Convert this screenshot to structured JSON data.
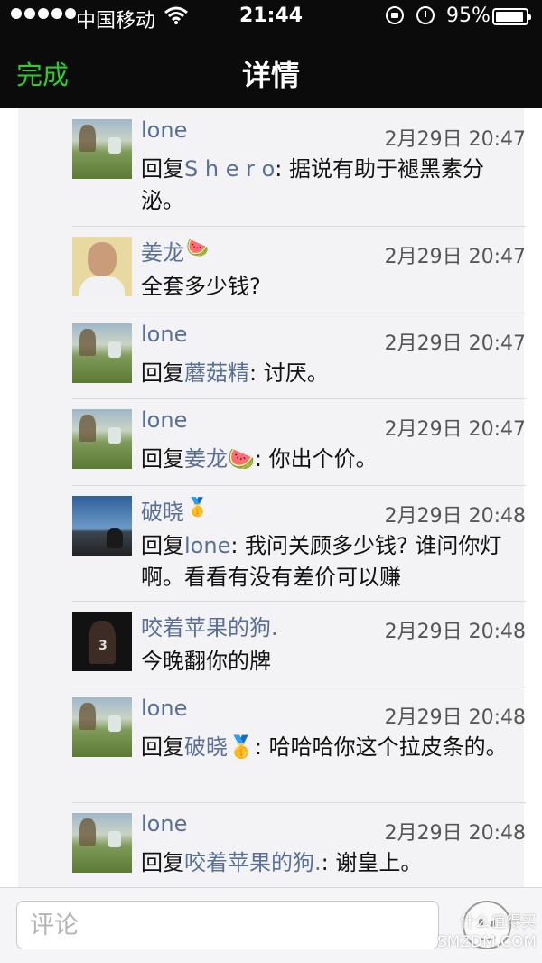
{
  "status_bar": {
    "carrier": "中国移动",
    "time": "21:44",
    "battery_percent": "95%",
    "battery_level": 0.95
  },
  "nav": {
    "done_label": "完成",
    "title": "详情"
  },
  "comments": [
    {
      "name": "lone",
      "time": "2月29日 20:47",
      "prefix": "回复",
      "ref": "S h e r o",
      "text": ": 据说有助于褪黑素分泌。",
      "avatar": "landscape-photo"
    },
    {
      "name": "姜龙",
      "name_emoji": "🍉",
      "time": "2月29日 20:47",
      "prefix": "",
      "ref": "",
      "text": "全套多少钱?",
      "avatar": "portrait-photo"
    },
    {
      "name": "lone",
      "time": "2月29日 20:47",
      "prefix": "回复",
      "ref": "蘑菇精",
      "text": ": 讨厌。",
      "avatar": "landscape-photo"
    },
    {
      "name": "lone",
      "time": "2月29日 20:47",
      "prefix": "回复",
      "ref": "姜龙🍉",
      "text": ": 你出个价。",
      "avatar": "landscape-photo"
    },
    {
      "name": "破晓",
      "name_emoji": "🥇",
      "time": "2月29日 20:48",
      "prefix": "回复",
      "ref": "lone",
      "text": ": 我问关顾多少钱? 谁问你灯啊。看看有没有差价可以赚",
      "avatar": "lake-photo"
    },
    {
      "name": "咬着苹果的狗.",
      "time": "2月29日 20:48",
      "prefix": "",
      "ref": "",
      "text": "今晚翻你的牌",
      "avatar": "basketball-jersey-photo"
    },
    {
      "name": "lone",
      "time": "2月29日 20:48",
      "prefix": "回复",
      "ref": "破晓🥇",
      "text": ": 哈哈哈你这个拉皮条的。",
      "avatar": "landscape-photo"
    },
    {
      "name": "lone",
      "time": "2月29日 20:48",
      "prefix": "回复",
      "ref": "咬着苹果的狗.",
      "text": ": 谢皇上。",
      "avatar": "landscape-photo"
    }
  ],
  "input": {
    "placeholder": "评论",
    "value": ""
  },
  "watermark": {
    "line1": "什么值得买",
    "line2": "SMZDM.COM"
  }
}
